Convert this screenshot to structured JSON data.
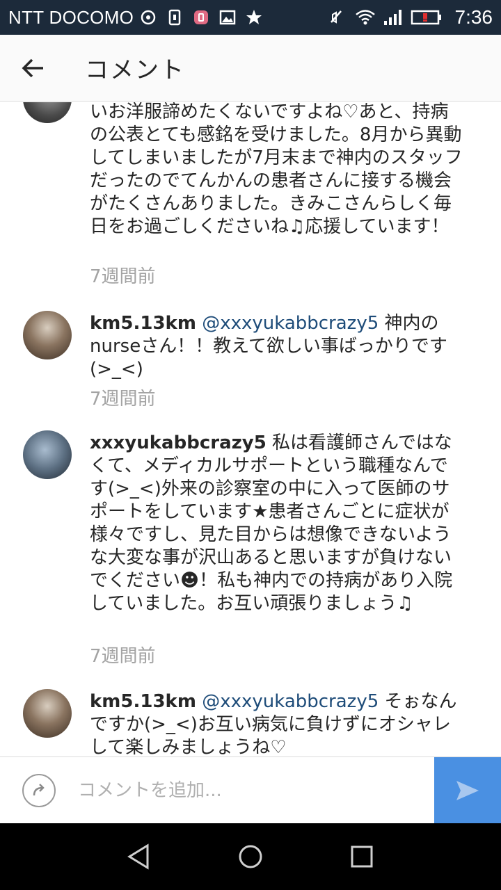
{
  "status_bar": {
    "carrier": "NTT DOCOMO",
    "time": "7:36",
    "icons_left": [
      "nfc-icon",
      "sim-icon",
      "app-icon",
      "image-icon",
      "star-icon"
    ],
    "icons_right": [
      "mute-icon",
      "wifi-icon",
      "signal-icon",
      "battery-icon"
    ]
  },
  "app_bar": {
    "title": "コメント"
  },
  "comments": [
    {
      "text": "いお洋服諦めたくないですよね♡あと、持病の公表とても感銘を受けました。8月から異動してしまいましたが7月末まで神内のスタッフだったのでてんかんの患者さんに接する機会がたくさんありました。きみこさんらしく毎日をお過ごしくださいね♫応援しています！",
      "time": "7週間前"
    },
    {
      "username": "km5.13km",
      "mention": "@xxxyukabbcrazy5",
      "text": "神内のnurseさん！！教えて欲しい事ばっかりです(>_<)",
      "time": "7週間前"
    },
    {
      "username": "xxxyukabbcrazy5",
      "text": "私は看護師さんではなくて、メディカルサポートという職種なんです(>_<)外来の診察室の中に入って医師のサポートをしています★患者さんごとに症状が様々ですし、見た目からは想像できないような大変な事が沢山あると思いますが負けないでください☻！私も神内での持病があり入院していました。お互い頑張りましょう♫",
      "time": "7週間前"
    },
    {
      "username": "km5.13km",
      "mention": "@xxxyukabbcrazy5",
      "text": "そぉなんですか(>_<)お互い病気に負けずにオシャレして楽しみましょうね♡"
    }
  ],
  "composer": {
    "placeholder": "コメントを追加..."
  },
  "colors": {
    "status_bar_bg": "#1c2a3a",
    "mention": "#1e4c79",
    "timestamp": "#a3a3a3",
    "send_button": "#4a90e2"
  }
}
